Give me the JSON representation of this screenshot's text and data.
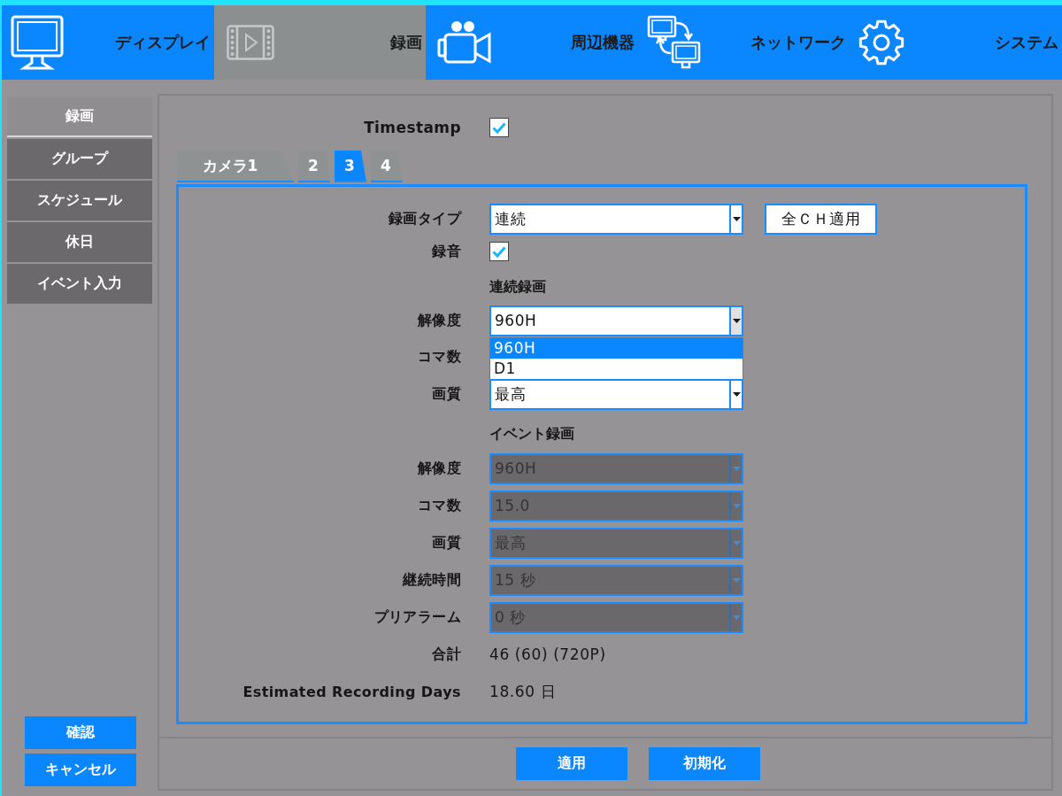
{
  "nav_tabs": [
    {
      "label": "ディスプレイ",
      "selected": false
    },
    {
      "label": "録画",
      "selected": true
    },
    {
      "label": "周辺機器",
      "selected": false
    },
    {
      "label": "ネットワーク",
      "selected": false
    },
    {
      "label": "システム",
      "selected": false
    }
  ],
  "sidebar": {
    "items": [
      {
        "label": "録画",
        "selected": true
      },
      {
        "label": "グループ",
        "selected": false
      },
      {
        "label": "スケジュール",
        "selected": false
      },
      {
        "label": "休日",
        "selected": false
      },
      {
        "label": "イベント入力",
        "selected": false
      }
    ],
    "buttons": [
      "確認",
      "キャンセル"
    ]
  },
  "timestamp": {
    "label": "Timestamp",
    "checked": true
  },
  "camera_tabs": [
    {
      "label": "カメラ1",
      "selected": false
    },
    {
      "label": "2",
      "selected": false
    },
    {
      "label": "3",
      "selected": true
    },
    {
      "label": "4",
      "selected": false
    }
  ],
  "rows": [
    {
      "kind": "select",
      "label": "録画タイプ",
      "value": "連続",
      "disabled": false,
      "expanded": false,
      "button": "全ＣＨ適用"
    },
    {
      "kind": "checkbox",
      "label": "録音",
      "checked": true
    },
    {
      "kind": "heading",
      "label": "連続録画"
    },
    {
      "kind": "select",
      "label": "解像度",
      "value": "960H",
      "disabled": false,
      "expanded": true,
      "options": [
        {
          "label": "960H",
          "selected": true
        },
        {
          "label": "D1",
          "selected": false
        }
      ]
    },
    {
      "kind": "select",
      "label": "コマ数"
    },
    {
      "kind": "select",
      "label": "画質",
      "value": "最高",
      "disabled": false,
      "expanded": false
    },
    {
      "kind": "heading",
      "label": "イベント録画"
    },
    {
      "kind": "select",
      "label": "解像度",
      "value": "960H",
      "disabled": true,
      "expanded": false
    },
    {
      "kind": "select",
      "label": "コマ数",
      "value": "15.0",
      "disabled": true,
      "expanded": false
    },
    {
      "kind": "select",
      "label": "画質",
      "value": "最高",
      "disabled": true,
      "expanded": false
    },
    {
      "kind": "select",
      "label": "継続時間",
      "value": "15 秒",
      "disabled": true,
      "expanded": false
    },
    {
      "kind": "select",
      "label": "プリアラーム",
      "value": "0 秒",
      "disabled": true,
      "expanded": false
    },
    {
      "kind": "text",
      "label": "合計",
      "value": "46 (60) (720P)"
    },
    {
      "kind": "text",
      "label": "Estimated Recording Days",
      "value": "18.60 日"
    }
  ],
  "footer_buttons": [
    "適用",
    "初期化"
  ]
}
